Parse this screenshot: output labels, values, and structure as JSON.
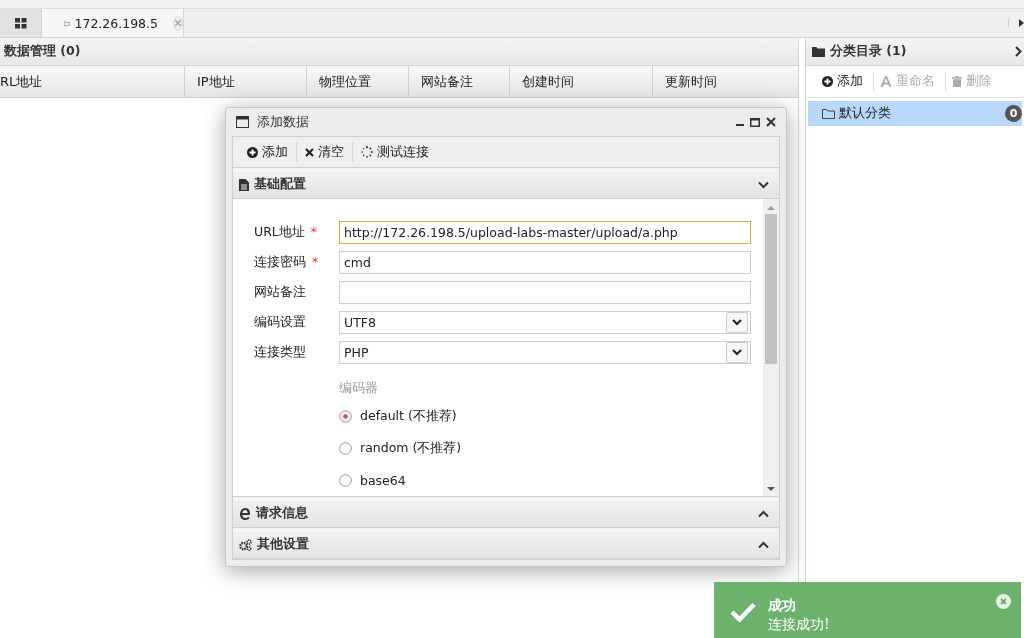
{
  "tabs": [
    {
      "kind": "home",
      "selected": false
    },
    {
      "kind": "host",
      "label": "172.26.198.5",
      "selected": true
    }
  ],
  "data_panel": {
    "title": "数据管理 (0)",
    "columns": [
      "RL地址",
      "IP地址",
      "物理位置",
      "网站备注",
      "创建时间",
      "更新时间"
    ]
  },
  "category_panel": {
    "title": "分类目录 (1)",
    "toolbar": [
      {
        "kind": "add",
        "label": "添加",
        "disabled": false
      },
      {
        "kind": "rename",
        "label": "重命名",
        "disabled": true
      },
      {
        "kind": "delete",
        "label": "删除",
        "disabled": true
      }
    ],
    "items": [
      {
        "label": "默认分类",
        "count": "0",
        "selected": true
      }
    ]
  },
  "dialog": {
    "title": "添加数据",
    "toolbar": [
      {
        "kind": "add",
        "label": "添加"
      },
      {
        "kind": "clear",
        "label": "清空"
      },
      {
        "kind": "test",
        "label": "测试连接"
      }
    ],
    "sections": [
      {
        "kind": "doc",
        "title": "基础配置",
        "expanded": true
      },
      {
        "kind": "browser",
        "title": "请求信息",
        "expanded": false
      },
      {
        "kind": "gears",
        "title": "其他设置",
        "expanded": false
      }
    ],
    "fields": [
      {
        "kind": "text",
        "label": "URL地址",
        "required_mark": "*",
        "value": "http://172.26.198.5/upload-labs-master/upload/a.php",
        "focused": true
      },
      {
        "kind": "text",
        "label": "连接密码",
        "required_mark": "*",
        "value": "cmd",
        "focused": false
      },
      {
        "kind": "text",
        "label": "网站备注",
        "focused": false
      },
      {
        "kind": "select",
        "label": "编码设置",
        "value": "UTF8",
        "focused": false
      },
      {
        "kind": "select",
        "label": "连接类型",
        "value": "PHP",
        "focused": false
      }
    ],
    "encoder_label": "编码器",
    "encoders": [
      {
        "label": "default (不推荐)",
        "selected": true
      },
      {
        "label": "random (不推荐)",
        "selected": false
      },
      {
        "label": "base64",
        "selected": false
      }
    ]
  },
  "toast": {
    "title": "成功",
    "message": "连接成功!"
  }
}
